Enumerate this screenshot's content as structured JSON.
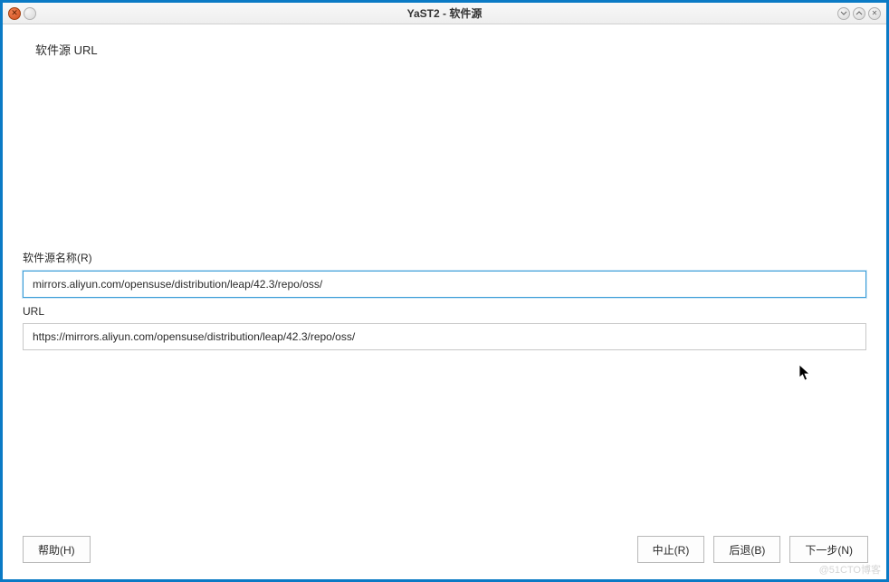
{
  "window": {
    "title": "YaST2  -  软件源"
  },
  "heading": "软件源 URL",
  "fields": {
    "repo_name": {
      "label": "软件源名称(R)",
      "value": "mirrors.aliyun.com/opensuse/distribution/leap/42.3/repo/oss/"
    },
    "url": {
      "label": "URL",
      "value": "https://mirrors.aliyun.com/opensuse/distribution/leap/42.3/repo/oss/"
    }
  },
  "buttons": {
    "help": "帮助(H)",
    "abort": "中止(R)",
    "back": "后退(B)",
    "next": "下一步(N)"
  },
  "watermark": "@51CTO博客"
}
